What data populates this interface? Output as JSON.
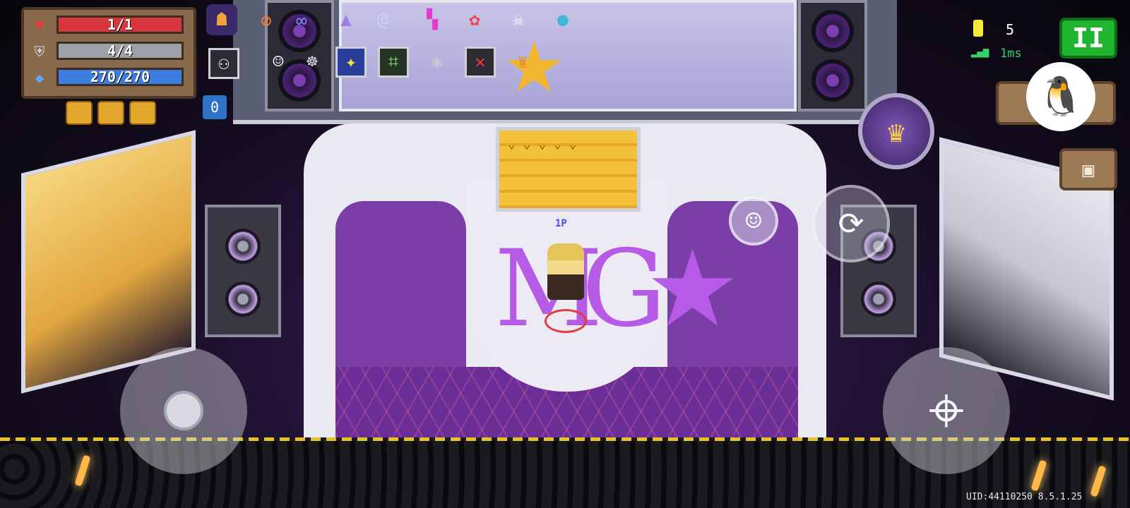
{
  "hud": {
    "hp": {
      "text": "1/1",
      "fraction": 1.0,
      "color": "#d7363c",
      "icon": "heart-icon"
    },
    "armor": {
      "text": "4/4",
      "fraction": 1.0,
      "color": "#9ea0a8",
      "icon": "shield-icon"
    },
    "energy": {
      "text": "270/270",
      "fraction": 1.0,
      "color": "#3d7de0",
      "icon": "energy-crystal-icon"
    }
  },
  "inventory_icons": [
    "demon-mask-icon",
    "no-entry-icon",
    "infinity-icon",
    "wizard-hat-icon",
    "snail-icon",
    "tetris-block-icon",
    "octopus-icon",
    "skeleton-icon",
    "planet-icon",
    "alien-icon",
    "robot-mask-icon",
    "starry-map-icon",
    "maze-icon",
    "bug-swarm-icon",
    "red-x-icon",
    "spartan-helmet-icon"
  ],
  "top_right": {
    "gem_count": "5",
    "ping": "1ms",
    "pause_label": "II"
  },
  "hint_icon": {
    "label": "0"
  },
  "player": {
    "tag": "1P"
  },
  "stage": {
    "ramp_arrows": "⌄ ⌄ ⌄ ⌄ ⌄",
    "logo_text": "MG★"
  },
  "footer": {
    "uid": "UID:44110250 8.5.1.25"
  },
  "colors": {
    "accent": "#1fb52f",
    "stage_purple": "#7b3ea6",
    "gold": "#f2b72f"
  }
}
